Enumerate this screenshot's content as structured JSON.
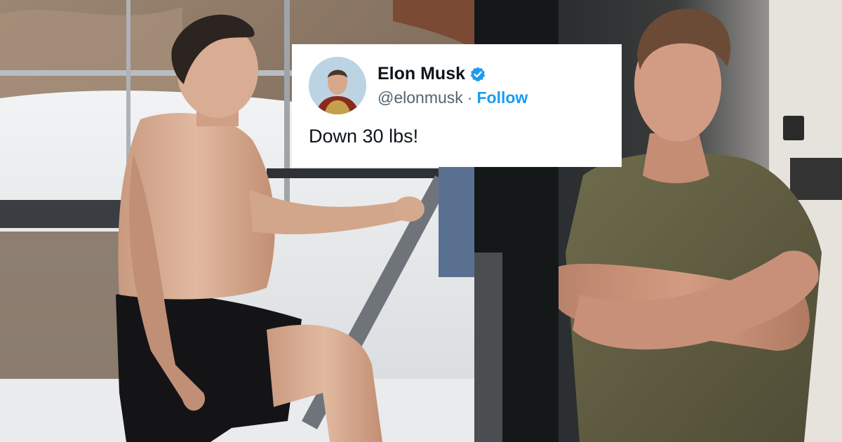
{
  "tweet": {
    "display_name": "Elon Musk",
    "handle": "@elonmusk",
    "separator": "·",
    "follow_label": "Follow",
    "text": "Down 30 lbs!",
    "verified_icon": "verified-badge-icon",
    "accent_color": "#1d9bf0"
  },
  "photos": {
    "left": "shirtless-man-on-boat-steps-photo",
    "right": "man-arms-crossed-olive-tshirt-photo"
  }
}
